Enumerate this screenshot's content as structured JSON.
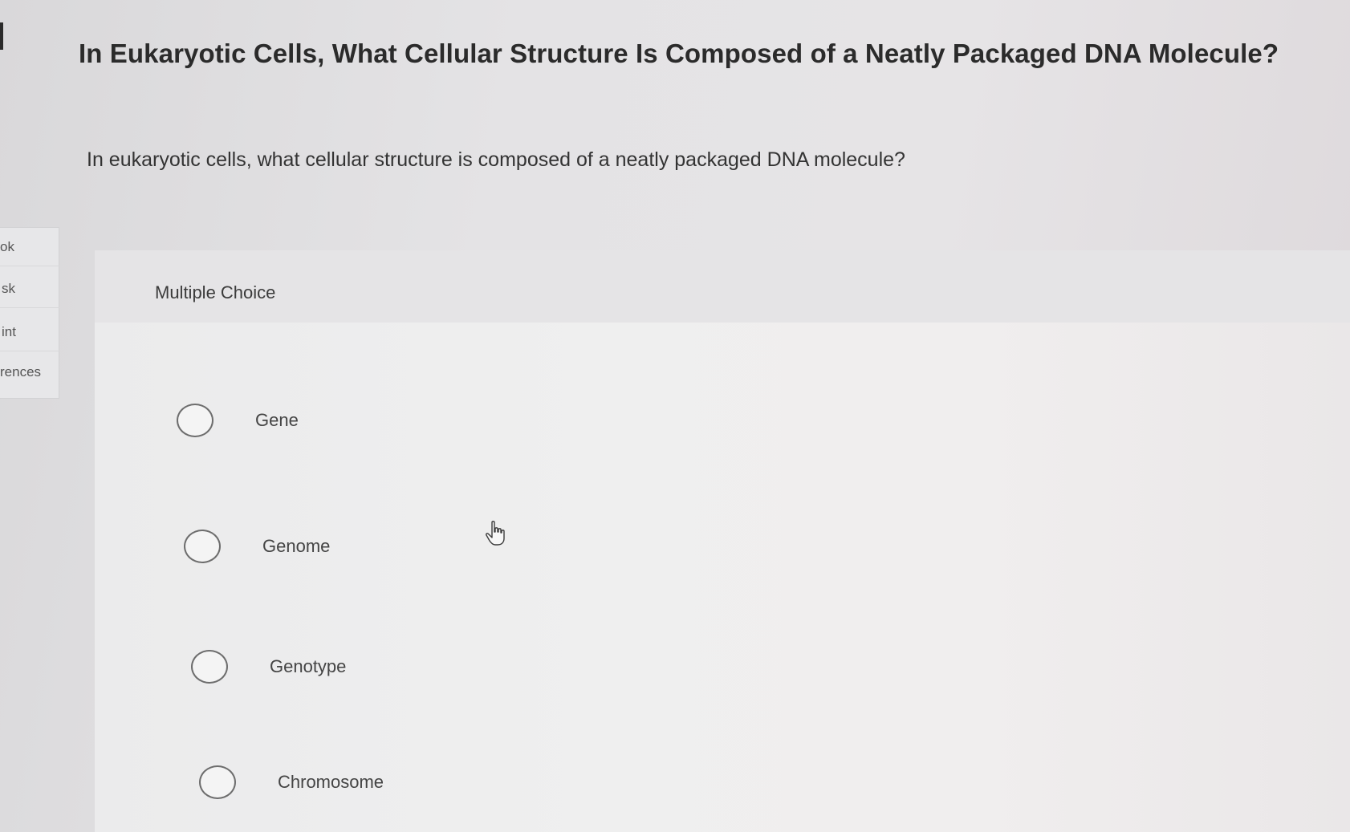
{
  "question": {
    "title": "In Eukaryotic Cells, What Cellular Structure Is Composed of a Neatly Packaged DNA Molecule?",
    "prompt": "In eukaryotic cells, what cellular structure is composed of a neatly packaged DNA molecule?"
  },
  "side_tabs": [
    {
      "label": "ok"
    },
    {
      "label": "sk"
    },
    {
      "label": "int"
    },
    {
      "label": "rences"
    }
  ],
  "panel": {
    "type_label": "Multiple Choice"
  },
  "choices": [
    {
      "label": "Gene",
      "selected": false
    },
    {
      "label": "Genome",
      "selected": false
    },
    {
      "label": "Genotype",
      "selected": false
    },
    {
      "label": "Chromosome",
      "selected": false
    }
  ],
  "icons": {
    "cursor": "hand-pointer-icon"
  }
}
